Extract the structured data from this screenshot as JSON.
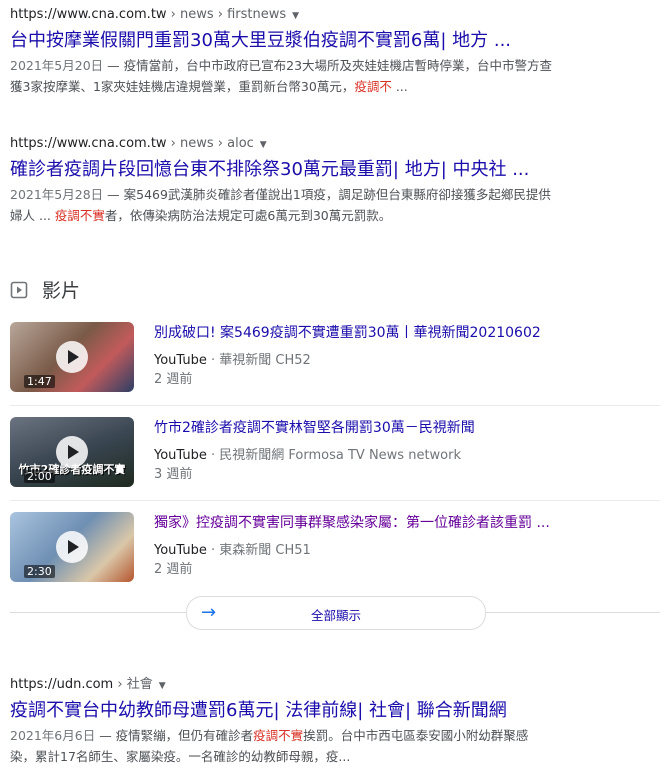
{
  "results": [
    {
      "domain": "https://www.cna.com.tw",
      "path": " › news › firstnews",
      "title": "台中按摩業假關門重罰30萬大里豆漿伯疫調不實罰6萬| 地方 ...",
      "date": "2021年5月20日",
      "snippet_line1": " — 疫情當前，台中市政府已宣布23大場所及夾娃娃機店暫時停業，台中市警方查",
      "snippet_line2_a": "獲3家按摩業、1家夾娃娃機店違規營業，重罰新台幣30萬元，",
      "snippet_line2_hl": "疫調不",
      "snippet_line2_b": " ..."
    },
    {
      "domain": "https://www.cna.com.tw",
      "path": " › news › aloc",
      "title": "確診者疫調片段回憶台東不排除祭30萬元最重罰| 地方| 中央社 ...",
      "date": "2021年5月28日",
      "snippet_line1": " — 案5469武漢肺炎確診者僅說出1項疫，調足跡但台東縣府卻接獲多起鄉民提供",
      "snippet_line2_a": "婦人 ... ",
      "snippet_line2_hl": "疫調不實",
      "snippet_line2_b": "者，依傳染病防治法規定可處6萬元到30萬元罰款。"
    }
  ],
  "videos_section": {
    "label": "影片"
  },
  "videos": [
    {
      "title": "別成破口! 案5469疫調不實遭重罰30萬丨華視新聞20210602",
      "source": "YouTube",
      "channel": " · 華視新聞 CH52",
      "time": "2 週前",
      "duration": "1:47",
      "caption": "",
      "visited": false,
      "thumb_color": "#7a5a48"
    },
    {
      "title": "竹市2確診者疫調不實林智堅各開罰30萬－民視新聞",
      "source": "YouTube",
      "channel": " · 民視新聞網 Formosa TV News network",
      "time": "3 週前",
      "duration": "2:00",
      "caption": "竹市2確診者疫調不實",
      "visited": false,
      "thumb_color": "#3a4652"
    },
    {
      "title": "獨家》控疫調不實害同事群聚感染家屬：第一位確診者該重罰 ...",
      "source": "YouTube",
      "channel": " · 東森新聞 CH51",
      "time": "2 週前",
      "duration": "2:30",
      "caption": "",
      "visited": true,
      "thumb_color": "#6f8fb3"
    }
  ],
  "more_button": {
    "label": "全部顯示"
  },
  "results2": [
    {
      "domain": "https://udn.com",
      "path": " › 社會",
      "title": "疫調不實台中幼教師母遭罰6萬元| 法律前線| 社會| 聯合新聞網",
      "date": "2021年6月6日",
      "snippet_line1_a": " — 疫情緊繃，但仍有確診者",
      "snippet_line1_hl": "疫調不實",
      "snippet_line1_b": "挨罰。台中市西屯區泰安國小附幼群聚感",
      "snippet_line2": "染，累計17名師生、家屬染疫。一名確診的幼教師母親，疫..."
    }
  ],
  "colors": {
    "link": "#1a0dab",
    "visited": "#660099",
    "highlight": "#d93025"
  }
}
